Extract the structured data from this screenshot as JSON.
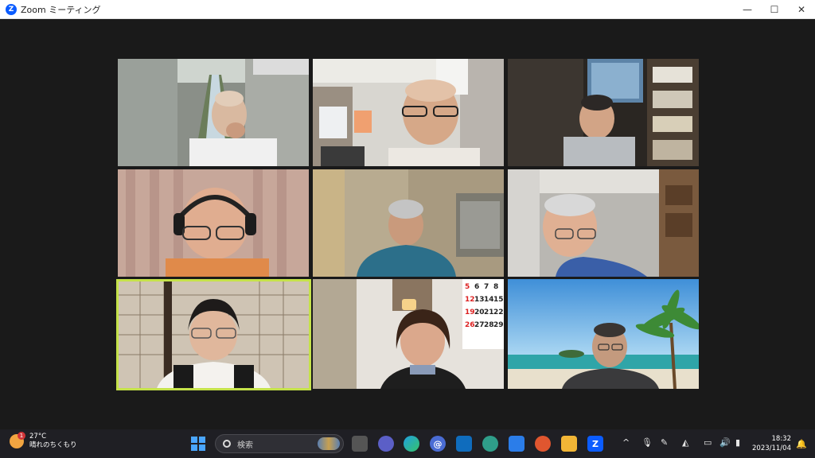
{
  "window": {
    "title": "Zoom ミーティング",
    "app_icon_letter": "Z",
    "minimize_glyph": "—",
    "maximize_glyph": "☐",
    "close_glyph": "✕"
  },
  "participants": [
    {
      "id": 1,
      "scene": "canal-street"
    },
    {
      "id": 2,
      "scene": "living-room-bald"
    },
    {
      "id": 3,
      "scene": "bookshelf-map"
    },
    {
      "id": 4,
      "scene": "curtain-headphones"
    },
    {
      "id": 5,
      "scene": "blurred-room"
    },
    {
      "id": 6,
      "scene": "room-corner"
    },
    {
      "id": 7,
      "scene": "shoji-woman",
      "active_speaker": true
    },
    {
      "id": 8,
      "scene": "calendar-woman"
    },
    {
      "id": 9,
      "scene": "tropical-beach"
    }
  ],
  "calendar_numbers": [
    "5",
    "6",
    "7",
    "8",
    "12",
    "13",
    "14",
    "15",
    "19",
    "20",
    "21",
    "22",
    "26",
    "27",
    "28",
    "29"
  ],
  "taskbar": {
    "weather": {
      "temp": "27°C",
      "condition": "晴れのちくもり",
      "badge": "1"
    },
    "search_placeholder": "検索",
    "pinned_apps": [
      "task-view",
      "teams-meet",
      "edge",
      "mail-at",
      "outlook",
      "maps",
      "store",
      "music",
      "file-explorer",
      "zoom"
    ],
    "zoom_letter": "Z",
    "mail_glyph": "@",
    "tray_chevron": "^",
    "clock_time": "18:32",
    "clock_date": "2023/11/04"
  },
  "colors": {
    "active_speaker_border": "#c5e24a",
    "zoom_blue": "#0b5cff",
    "background": "#1a1a1a"
  }
}
